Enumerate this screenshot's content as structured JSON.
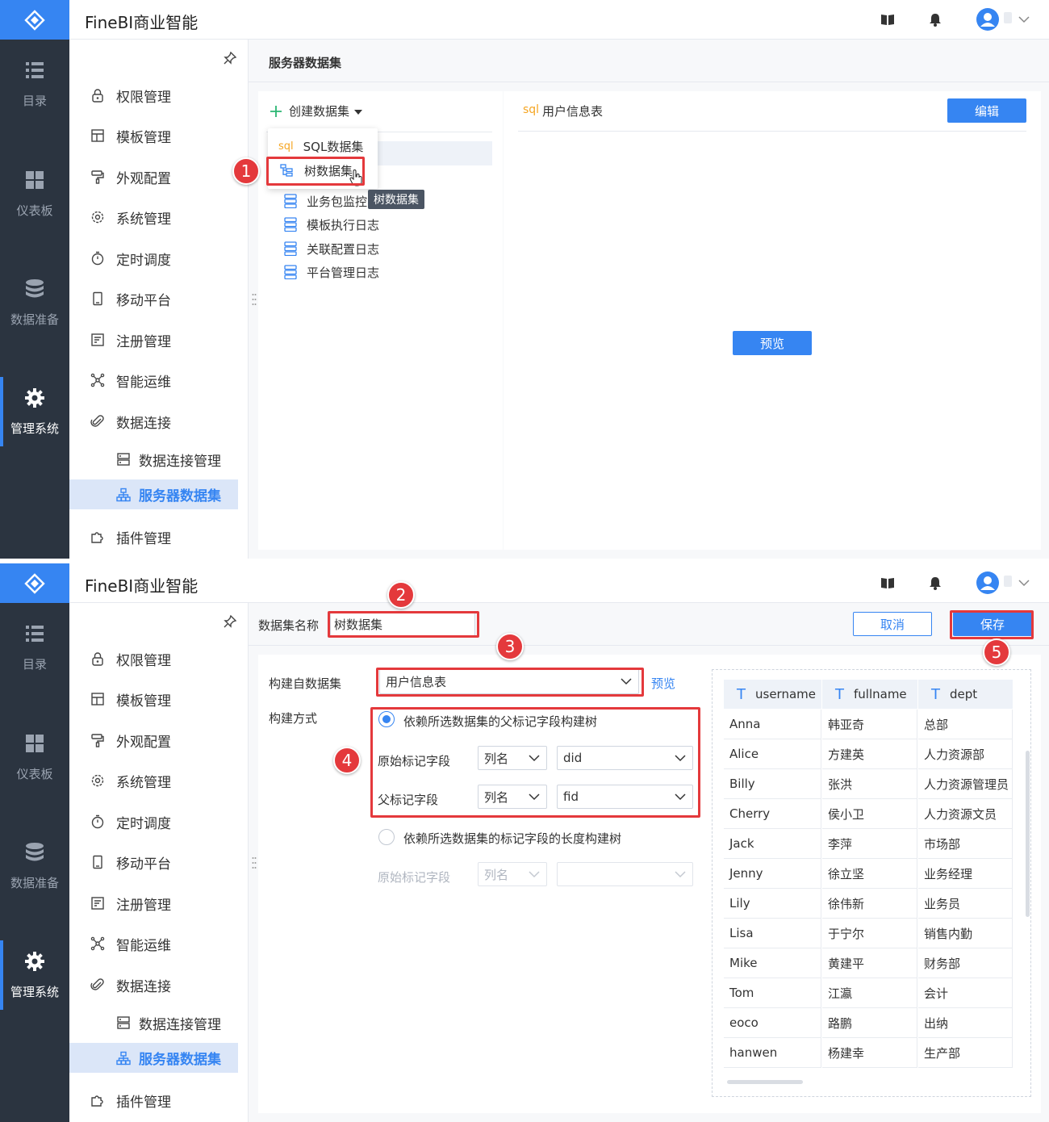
{
  "app": {
    "brand": "FineBI商业智能"
  },
  "rail": {
    "items": [
      {
        "label": "目录",
        "icon": "list-icon"
      },
      {
        "label": "仪表板",
        "icon": "dashboard-icon"
      },
      {
        "label": "数据准备",
        "icon": "database-icon"
      },
      {
        "label": "管理系统",
        "icon": "gear-icon"
      }
    ]
  },
  "sidebar": {
    "items": [
      {
        "label": "权限管理",
        "icon": "lock-icon"
      },
      {
        "label": "模板管理",
        "icon": "template-icon"
      },
      {
        "label": "外观配置",
        "icon": "paint-roller-icon"
      },
      {
        "label": "系统管理",
        "icon": "settings-icon"
      },
      {
        "label": "定时调度",
        "icon": "timer-icon"
      },
      {
        "label": "移动平台",
        "icon": "mobile-icon"
      },
      {
        "label": "注册管理",
        "icon": "register-icon"
      },
      {
        "label": "智能运维",
        "icon": "network-icon"
      },
      {
        "label": "数据连接",
        "icon": "paperclip-icon"
      },
      {
        "label": "数据连接管理",
        "icon": "server-icon"
      },
      {
        "label": "服务器数据集",
        "icon": "hierarchy-icon"
      },
      {
        "label": "插件管理",
        "icon": "puzzle-icon"
      }
    ]
  },
  "panel1": {
    "breadcrumb": "服务器数据集",
    "create_button": "创建数据集",
    "menu": {
      "sql_tag": "sql",
      "sql_label": "SQL数据集",
      "tree_label": "树数据集"
    },
    "tooltip": "树数据集",
    "list": [
      "业务包监控日",
      "模板执行日志",
      "关联配置日志",
      "平台管理日志"
    ],
    "detail": {
      "sql_tag": "sql",
      "title": "用户信息表",
      "edit_button": "编辑",
      "preview_button": "预览"
    },
    "badge": "1"
  },
  "panel2": {
    "name_label": "数据集名称",
    "name_value": "树数据集",
    "cancel_button": "取消",
    "save_button": "保存",
    "source_label": "构建自数据集",
    "source_value": "用户信息表",
    "preview_link": "预览",
    "method_label": "构建方式",
    "option1": "依赖所选数据集的父标记字段构建树",
    "orig_field_label": "原始标记字段",
    "parent_field_label": "父标记字段",
    "col_type": "列名",
    "orig_field_value": "did",
    "parent_field_value": "fid",
    "option2": "依赖所选数据集的标记字段的长度构建树",
    "orig_field_label2": "原始标记字段",
    "col_type2": "列名",
    "badges": [
      "2",
      "3",
      "4",
      "5"
    ],
    "grid": {
      "type_glyph": "T",
      "columns": [
        "username",
        "fullname",
        "dept"
      ],
      "rows": [
        [
          "Anna",
          "韩亚奇",
          "总部"
        ],
        [
          "Alice",
          "方建英",
          "人力资源部"
        ],
        [
          "Billy",
          "张洪",
          "人力资源管理员"
        ],
        [
          "Cherry",
          "侯小卫",
          "人力资源文员"
        ],
        [
          "Jack",
          "李萍",
          "市场部"
        ],
        [
          "Jenny",
          "徐立坚",
          "业务经理"
        ],
        [
          "Lily",
          "徐伟新",
          "业务员"
        ],
        [
          "Lisa",
          "于宁尔",
          "销售内勤"
        ],
        [
          "Mike",
          "黄建平",
          "财务部"
        ],
        [
          "Tom",
          "江瀛",
          "会计"
        ],
        [
          "eoco",
          "路鹏",
          "出纳"
        ],
        [
          "hanwen",
          "杨建幸",
          "生产部"
        ]
      ]
    }
  },
  "colors": {
    "accent": "#3685f2",
    "rail": "#2b3440",
    "highlight": "#e4393c"
  }
}
